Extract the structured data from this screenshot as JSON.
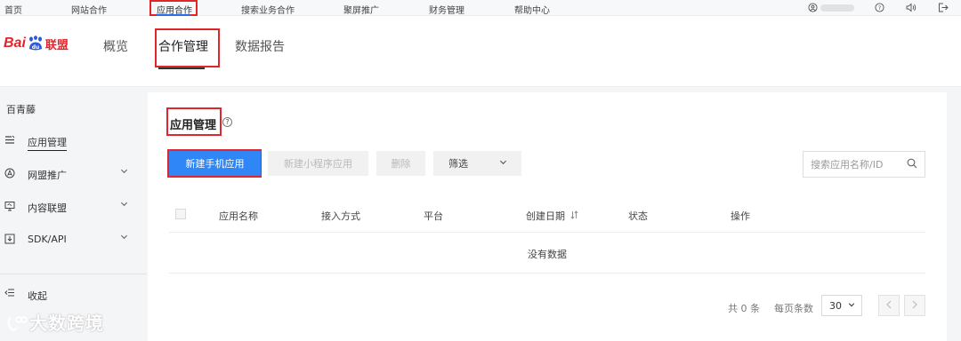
{
  "topnav": {
    "items": [
      "首页",
      "网站合作",
      "应用合作",
      "搜索业务合作",
      "聚屏推广",
      "财务管理",
      "帮助中心"
    ],
    "active_index": 2,
    "icons": [
      "user-icon",
      "help-circle-icon",
      "sound-icon",
      "logout-icon"
    ]
  },
  "brand": {
    "logo_text_bai": "Bai",
    "logo_text_du": "du",
    "logo_text_lm": "联盟",
    "color": "#e0262b"
  },
  "header": {
    "tabs": [
      "概览",
      "合作管理",
      "数据报告"
    ],
    "active_index": 1
  },
  "sidebar": {
    "account": "百青藤",
    "items": [
      {
        "label": "应用管理",
        "icon": "list-icon",
        "active": true,
        "expandable": false
      },
      {
        "label": "网盟推广",
        "icon": "compass-icon",
        "active": false,
        "expandable": true
      },
      {
        "label": "内容联盟",
        "icon": "monitor-icon",
        "active": false,
        "expandable": true
      },
      {
        "label": "SDK/API",
        "icon": "download-box-icon",
        "active": false,
        "expandable": true
      }
    ],
    "collapse_label": "收起"
  },
  "watermark": "大数跨境",
  "main": {
    "title": "应用管理",
    "buttons": {
      "new_mobile_app": "新建手机应用",
      "new_mini_program": "新建小程序应用",
      "delete": "删除",
      "filter": "筛选"
    },
    "search": {
      "placeholder": "搜索应用名称/ID",
      "value": ""
    },
    "table": {
      "columns": [
        "应用名称",
        "接入方式",
        "平台",
        "创建日期",
        "状态",
        "操作"
      ],
      "sortable_column": "创建日期",
      "empty_text": "没有数据"
    },
    "pagination": {
      "total_text": "共 0 条",
      "per_page_label": "每页条数",
      "page_size": "30"
    }
  },
  "colors": {
    "primary": "#2f86f6",
    "highlight": "#e0262b"
  }
}
